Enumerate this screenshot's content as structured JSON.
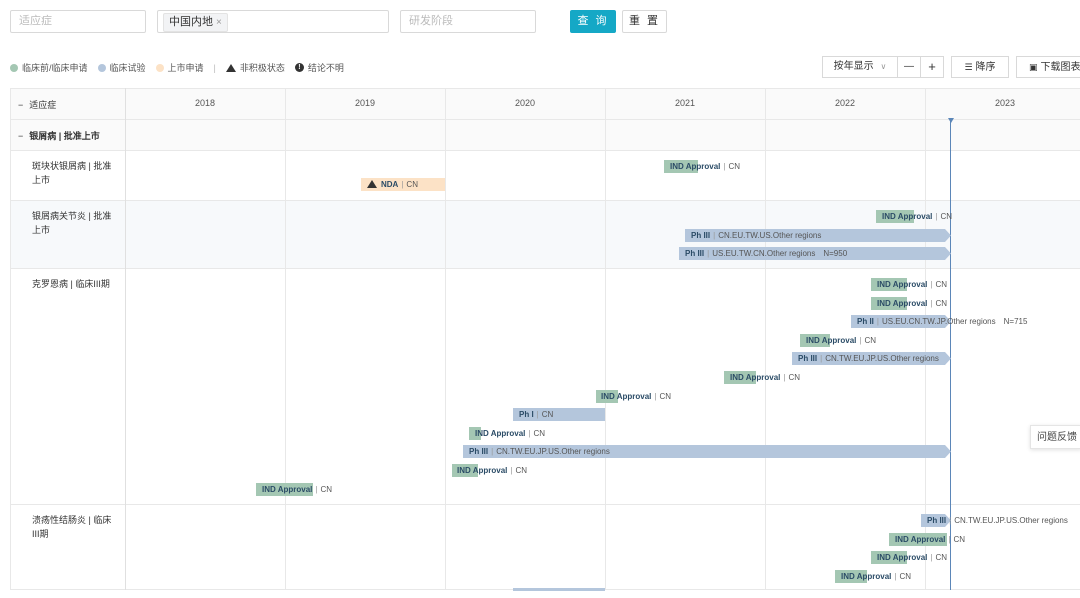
{
  "filters": {
    "indication_placeholder": "适应症",
    "region_chip": "中国内地",
    "chip_close": "×",
    "phase_placeholder": "研发阶段",
    "search_label": "查 询",
    "reset_label": "重 置"
  },
  "legend": {
    "items": [
      {
        "label": "临床前/临床申请",
        "color": "#a4c7b3"
      },
      {
        "label": "临床试验",
        "color": "#b4c6dc"
      },
      {
        "label": "上市申请",
        "color": "#fce2c6"
      }
    ],
    "separator": "|",
    "inactive_label": "非积极状态",
    "unknown_label": "结论不明"
  },
  "toolbar": {
    "view_mode": "按年显示",
    "view_chevron": "∨",
    "zoom_out": "—",
    "zoom_in": "+",
    "sort_label": "降序",
    "download_label": "下载图表"
  },
  "table": {
    "header_label": "适应症",
    "collapse_symbol": "−",
    "years": [
      "2018",
      "2019",
      "2020",
      "2021",
      "2022",
      "2023"
    ],
    "group_label": "银屑病 | 批准上市",
    "rows": [
      {
        "label": "斑块状银屑病 | 批准上市"
      },
      {
        "label": "银屑病关节炎 | 批准上市"
      },
      {
        "label": "克罗恩病 | 临床III期"
      },
      {
        "label": "溃疡性结肠炎 | 临床III期"
      }
    ]
  },
  "bars": [
    {
      "stage": "IND Approval",
      "region": "CN",
      "color": "green"
    },
    {
      "stage": "NDA",
      "region": "CN",
      "color": "orange",
      "inactive": true
    },
    {
      "stage": "IND Approval",
      "region": "CN",
      "color": "green"
    },
    {
      "stage": "Ph III",
      "region": "CN.EU.TW.US.Other regions",
      "color": "blue"
    },
    {
      "stage": "Ph III",
      "region": "US.EU.TW.CN.Other regions",
      "color": "blue",
      "n": "N=950"
    },
    {
      "stage": "IND Approval",
      "region": "CN",
      "color": "green"
    },
    {
      "stage": "IND Approval",
      "region": "CN",
      "color": "green"
    },
    {
      "stage": "Ph II",
      "region": "US.EU.CN.TW.JP.Other regions",
      "color": "blue",
      "n": "N=715"
    },
    {
      "stage": "IND Approval",
      "region": "CN",
      "color": "green"
    },
    {
      "stage": "Ph III",
      "region": "CN.TW.EU.JP.US.Other regions",
      "color": "blue"
    },
    {
      "stage": "IND Approval",
      "region": "CN",
      "color": "green"
    },
    {
      "stage": "IND Approval",
      "region": "CN",
      "color": "green"
    },
    {
      "stage": "Ph I",
      "region": "CN",
      "color": "blue"
    },
    {
      "stage": "IND Approval",
      "region": "CN",
      "color": "green"
    },
    {
      "stage": "Ph III",
      "region": "CN.TW.EU.JP.US.Other regions",
      "color": "blue"
    },
    {
      "stage": "IND Approval",
      "region": "CN",
      "color": "green"
    },
    {
      "stage": "IND Approval",
      "region": "CN",
      "color": "green"
    },
    {
      "stage": "Ph III",
      "region": "CN.TW.EU.JP.US.Other regions",
      "color": "blue"
    },
    {
      "stage": "IND Approval",
      "region": "CN",
      "color": "green"
    },
    {
      "stage": "IND Approval",
      "region": "CN",
      "color": "green"
    },
    {
      "stage": "IND Approval",
      "region": "CN",
      "color": "green"
    }
  ],
  "feedback_label": "问题反馈"
}
